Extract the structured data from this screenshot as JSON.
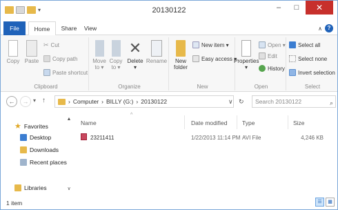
{
  "window": {
    "title": "20130122",
    "minimize_glyph": "–",
    "maximize_glyph": "□",
    "close_glyph": "✕"
  },
  "tabs": {
    "file": "File",
    "home": "Home",
    "share": "Share",
    "view": "View"
  },
  "ribbon_controls": {
    "collapse_glyph": "∧",
    "help_glyph": "?"
  },
  "ribbon": {
    "clipboard": {
      "group_label": "Clipboard",
      "copy": "Copy",
      "paste": "Paste",
      "cut": "Cut",
      "copy_path": "Copy path",
      "paste_shortcut": "Paste shortcut"
    },
    "organize": {
      "group_label": "Organize",
      "move_to": "Move",
      "move_to_suffix": "to ▾",
      "copy_to": "Copy",
      "copy_to_suffix": "to ▾",
      "delete": "Delete",
      "delete_suffix": "▾",
      "rename": "Rename"
    },
    "new": {
      "group_label": "New",
      "new_folder_line1": "New",
      "new_folder_line2": "folder",
      "new_item": "New item ▾",
      "easy_access": "Easy access ▾"
    },
    "open": {
      "group_label": "Open",
      "properties": "Properties",
      "properties_suffix": "▾",
      "open": "Open ▾",
      "edit": "Edit",
      "history": "History"
    },
    "select": {
      "group_label": "Select",
      "select_all": "Select all",
      "select_none": "Select none",
      "invert_selection": "Invert selection"
    }
  },
  "address": {
    "back_glyph": "←",
    "forward_glyph": "→",
    "recent_glyph": "▾",
    "up_glyph": "↑",
    "crumbs": [
      "Computer",
      "BILLY (G:)",
      "20130122"
    ],
    "sep_glyph": "›",
    "dropdown_glyph": "∨",
    "refresh_glyph": "↻",
    "search_placeholder": "Search 20130122",
    "search_glyph": "⌕"
  },
  "sidebar": {
    "favorites": "Favorites",
    "items": [
      "Desktop",
      "Downloads",
      "Recent places"
    ],
    "libraries": "Libraries",
    "scroll_up": "▲",
    "scroll_down": "∨"
  },
  "columns": {
    "name": "Name",
    "date_modified": "Date modified",
    "type": "Type",
    "size": "Size",
    "sort_glyph": "^"
  },
  "files": [
    {
      "name": "23211411",
      "date_modified": "1/22/2013 11:14 PM",
      "type": "AVI File",
      "size": "4,246 KB"
    }
  ],
  "status": {
    "item_count": "1 item",
    "details_glyph": "☰",
    "tiles_glyph": "▦"
  },
  "colors": {
    "accent": "#1f62b9",
    "folder": "#e7b94a",
    "close": "#c7302c",
    "video_icon": "#a2213a"
  }
}
